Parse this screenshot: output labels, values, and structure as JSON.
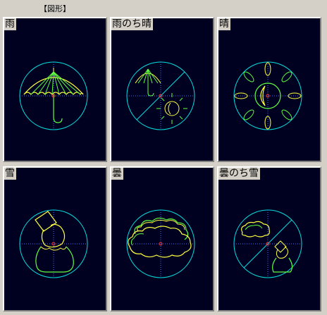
{
  "header": {
    "title": "【図形】"
  },
  "panels": [
    {
      "label": "雨",
      "icon": "umbrella-icon"
    },
    {
      "label": "雨のち晴",
      "icon": "umbrella-sun-icon"
    },
    {
      "label": "晴",
      "icon": "sun-icon"
    },
    {
      "label": "雪",
      "icon": "snowman-icon"
    },
    {
      "label": "曇",
      "icon": "cloud-icon"
    },
    {
      "label": "曇のち雪",
      "icon": "cloud-snowman-icon"
    }
  ],
  "colors": {
    "circle": "#00e0e0",
    "shape_primary": "#60ff40",
    "shape_secondary": "#ffff40",
    "crosshair": "#4070ff",
    "center_mark": "#ff3030",
    "panel_bg": "#000020"
  }
}
